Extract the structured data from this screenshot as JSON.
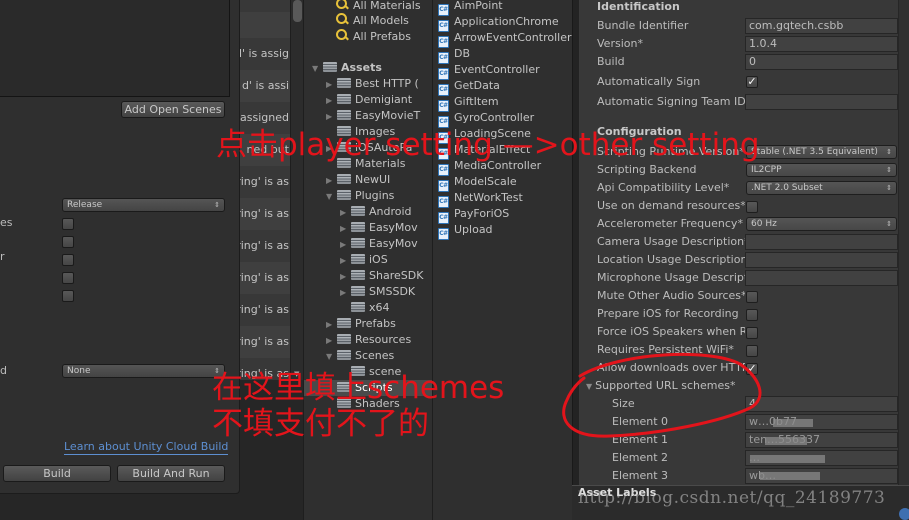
{
  "build_settings": {
    "add_open_scenes_label": "Add Open Scenes",
    "row_labels_partial": [
      "es",
      "r",
      "d"
    ],
    "build_config_select": "Release",
    "checkboxes": [
      false,
      false,
      false,
      false,
      false
    ],
    "compression_select": "None",
    "cloud_build_link": "Learn about Unity Cloud Build",
    "build_label": "Build",
    "build_and_run_label": "Build And Run"
  },
  "console": {
    "rows": [
      "d' is assig",
      "d' is assi",
      "assigned",
      "ned but",
      "ring' is as",
      "ring' is as",
      "ring' is as",
      "ring' is as",
      "ring' is as",
      "ring' is as",
      "ring' is as"
    ]
  },
  "project_tree": {
    "favorites": [
      {
        "label": "All Materials",
        "icon": "search-icon"
      },
      {
        "label": "All Models",
        "icon": "search-icon"
      },
      {
        "label": "All Prefabs",
        "icon": "search-icon"
      }
    ],
    "assets_label": "Assets",
    "items": [
      {
        "label": "Best HTTP (",
        "depth": 1,
        "expander": "collapsed"
      },
      {
        "label": "Demigiant",
        "depth": 1,
        "expander": "collapsed"
      },
      {
        "label": "EasyMovieT",
        "depth": 1,
        "expander": "collapsed"
      },
      {
        "label": "Images",
        "depth": 1,
        "expander": "none"
      },
      {
        "label": "iOSAutoPa",
        "depth": 1,
        "expander": "collapsed"
      },
      {
        "label": "Materials",
        "depth": 1,
        "expander": "none"
      },
      {
        "label": "NewUI",
        "depth": 1,
        "expander": "collapsed"
      },
      {
        "label": "Plugins",
        "depth": 1,
        "expander": "expanded"
      },
      {
        "label": "Android",
        "depth": 2,
        "expander": "collapsed"
      },
      {
        "label": "EasyMov",
        "depth": 2,
        "expander": "collapsed"
      },
      {
        "label": "EasyMov",
        "depth": 2,
        "expander": "collapsed"
      },
      {
        "label": "iOS",
        "depth": 2,
        "expander": "collapsed"
      },
      {
        "label": "ShareSDK",
        "depth": 2,
        "expander": "collapsed"
      },
      {
        "label": "SMSSDK",
        "depth": 2,
        "expander": "collapsed"
      },
      {
        "label": "x64",
        "depth": 2,
        "expander": "none"
      },
      {
        "label": "Prefabs",
        "depth": 1,
        "expander": "collapsed"
      },
      {
        "label": "Resources",
        "depth": 1,
        "expander": "collapsed"
      },
      {
        "label": "Scenes",
        "depth": 1,
        "expander": "expanded"
      },
      {
        "label": "scene",
        "depth": 2,
        "expander": "none"
      },
      {
        "label": "Scripts",
        "depth": 1,
        "expander": "none",
        "selected": true
      },
      {
        "label": "Shaders",
        "depth": 1,
        "expander": "none"
      }
    ]
  },
  "scripts": [
    "AimPoint",
    "ApplicationChrome",
    "ArrowEventController",
    "DB",
    "EventController",
    "GetData",
    "GiftItem",
    "GyroController",
    "LoadingScene",
    "MaterialEffect",
    "MediaController",
    "ModelScale",
    "NetWorkTest",
    "PayForiOS",
    "Upload"
  ],
  "script_icon_glyph": "C#",
  "inspector": {
    "identification": {
      "header": "Identification",
      "bundle_identifier_label": "Bundle Identifier",
      "bundle_identifier": "com.gqtech.csbb",
      "version_label": "Version*",
      "version": "1.0.4",
      "build_label": "Build",
      "build": "0",
      "auto_sign_label": "Automatically Sign",
      "auto_sign": true,
      "team_id_label": "Automatic Signing Team ID",
      "team_id": ""
    },
    "configuration": {
      "header": "Configuration",
      "runtime_label": "Scripting Runtime Version*",
      "runtime": "Stable (.NET 3.5 Equivalent)",
      "backend_label": "Scripting Backend",
      "backend": "IL2CPP",
      "api_label": "Api Compatibility Level*",
      "api": ".NET 2.0 Subset",
      "on_demand_label": "Use on demand resources*",
      "on_demand": false,
      "accel_label": "Accelerometer Frequency*",
      "accel": "60 Hz",
      "camera_label": "Camera Usage Description*",
      "location_label": "Location Usage Description",
      "microphone_label": "Microphone Usage Descript",
      "mute_label": "Mute Other Audio Sources*",
      "mute": false,
      "prepare_rec_label": "Prepare iOS for Recording",
      "prepare_rec": false,
      "force_speakers_label": "Force iOS Speakers when Re",
      "force_speakers": false,
      "wifi_label": "Requires Persistent WiFi*",
      "wifi": false,
      "http_label": "Allow downloads over HTTP",
      "http": true
    },
    "url_schemes": {
      "label": "Supported URL schemes*",
      "size_label": "Size",
      "size": "4",
      "elements": [
        {
          "label": "Element 0",
          "value": "w…0b77"
        },
        {
          "label": "Element 1",
          "value": "ten…556337"
        },
        {
          "label": "Element 2",
          "value": "…"
        },
        {
          "label": "Element 3",
          "value": "wb…"
        }
      ]
    }
  },
  "asset_labels": "Asset Labels",
  "watermark": "http://blog.csdn.net/qq_24189773",
  "annotations": {
    "line1": "点击player setting —>other setting",
    "line2": "在这里填上schemes",
    "line3": "不填支付不了的",
    "color": "#e3141b"
  }
}
